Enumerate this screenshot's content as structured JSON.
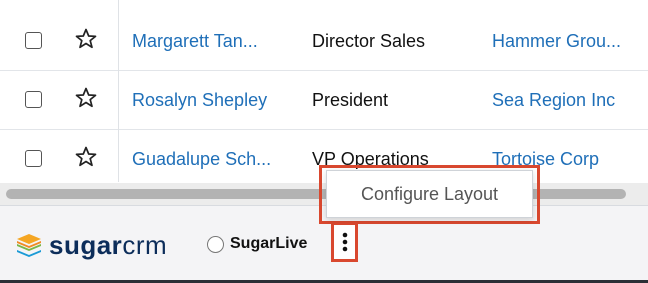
{
  "table": {
    "rows": [
      {
        "name": "Margarett Tan...",
        "title": "Director Sales",
        "account": "Hammer Grou..."
      },
      {
        "name": "Rosalyn Shepley",
        "title": "President",
        "account": "Sea Region Inc"
      },
      {
        "name": "Guadalupe Sch...",
        "title": "VP Operations",
        "account": "Tortoise Corp"
      }
    ]
  },
  "footer": {
    "logo_sugar": "sugar",
    "logo_crm": "crm",
    "sugarlive_label": "SugarLive",
    "more_icon": "kebab-vertical-icon"
  },
  "popup": {
    "configure_layout_label": "Configure Layout"
  },
  "colors": {
    "link": "#1f6fb8",
    "highlight": "#d9482f",
    "brand_navy": "#0c2d5a"
  }
}
